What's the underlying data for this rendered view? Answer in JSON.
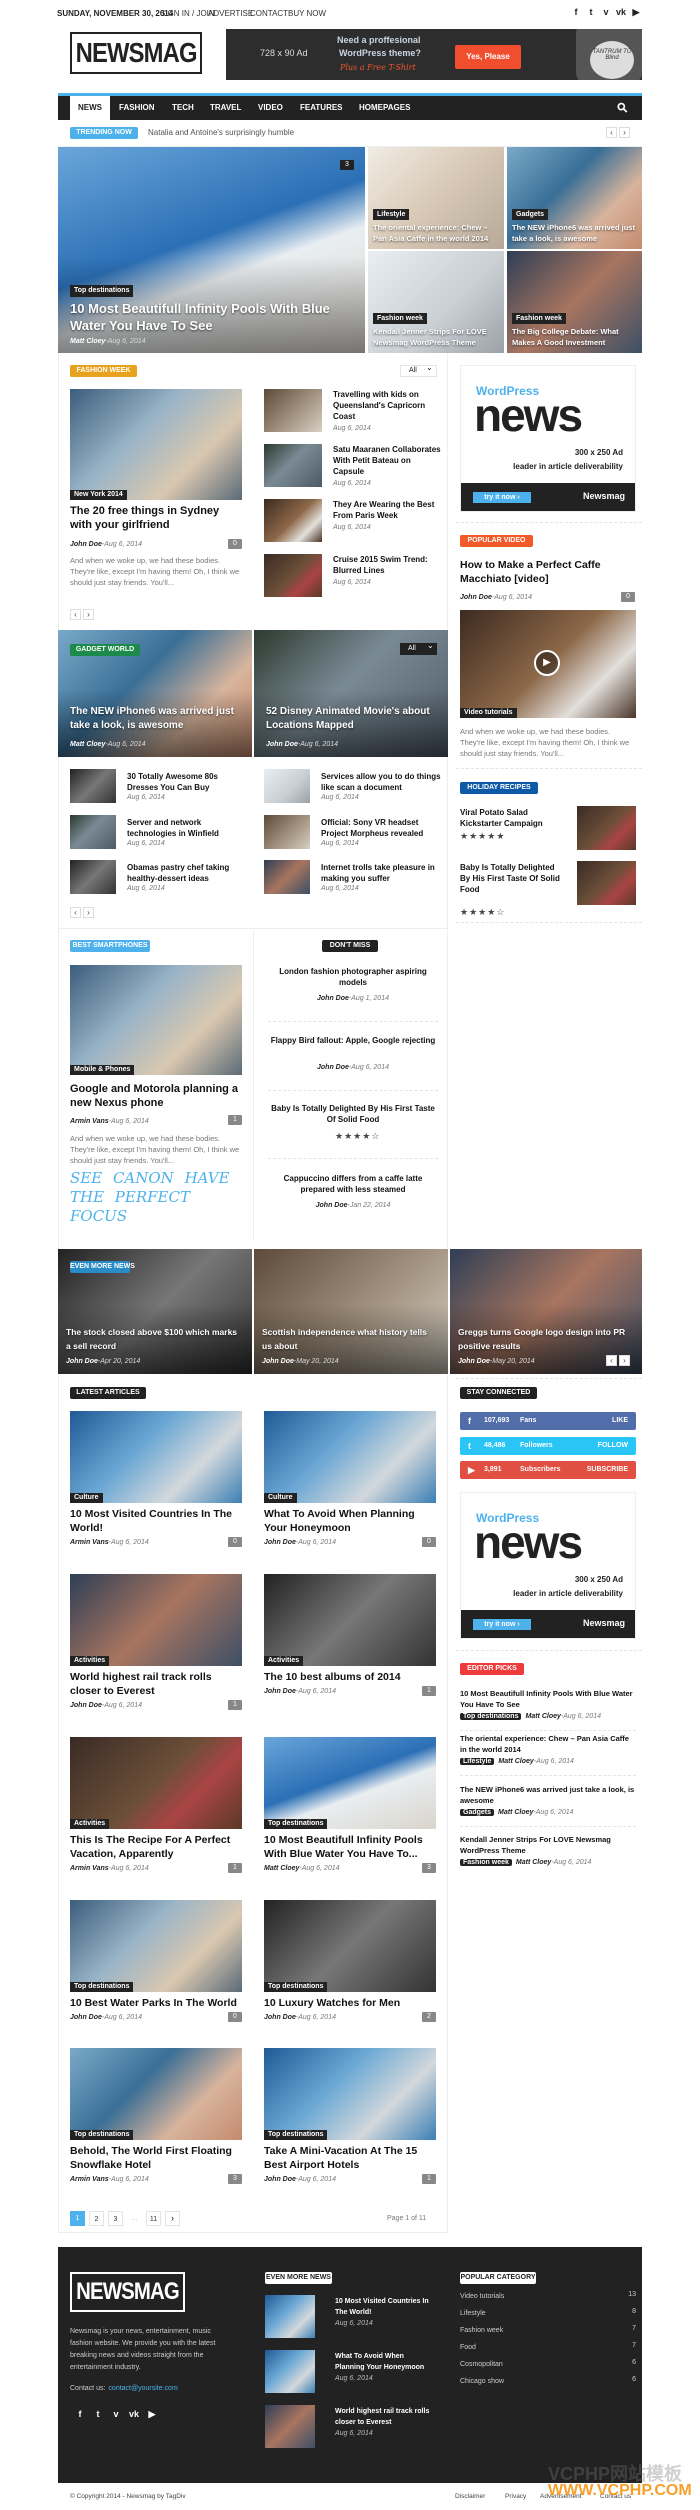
{
  "topbar": {
    "date": "SUNDAY, NOVEMBER 30, 2014",
    "links": [
      "SIGN IN / JOIN",
      "ADVERTISE",
      "CONTACT",
      "BUY NOW"
    ],
    "social": [
      "facebook-icon",
      "twitter-icon",
      "vimeo-icon",
      "vk-icon",
      "youtube-icon"
    ]
  },
  "header": {
    "logo": "NEWSMAG",
    "ad": {
      "size": "728 x 90 Ad",
      "line1": "Need a proffesional",
      "line2": "WordPress theme?",
      "line3": "Plus a Free T-Shirt",
      "button": "Yes, Please",
      "shirt_text": "TANTRUM TO Blind"
    }
  },
  "nav": {
    "items": [
      "NEWS",
      "FASHION",
      "TECH",
      "TRAVEL",
      "VIDEO",
      "FEATURES",
      "HOMEPAGES"
    ],
    "active": "NEWS"
  },
  "trending": {
    "label": "TRENDING NOW",
    "text": "Natalia and Antoine's surprisingly humble"
  },
  "hero": {
    "main": {
      "category": "Top destinations",
      "title": "10 Most Beautifull Infinity Pools With Blue Water You Have To See",
      "author": "Matt Cloey",
      "date": "Aug 6, 2014",
      "comments": "3"
    },
    "tiles": [
      {
        "category": "Lifestyle",
        "title": "The oriental experience: Chew – Pan Asia Caffe in the world 2014"
      },
      {
        "category": "Gadgets",
        "title": "The NEW iPhone6 was arrived just take a look, is awesome"
      },
      {
        "category": "Fashion week",
        "title": "Kendall Jenner Strips For LOVE Newsmag WordPress Theme"
      },
      {
        "category": "Fashion week",
        "title": "The Big College Debate: What Makes A Good Investment"
      }
    ]
  },
  "excerpt": "And when we woke up, we had these bodies. They're like, except I'm having them! Oh, I think we should just stay friends. You'll...",
  "fashion": {
    "label": "FASHION WEEK",
    "filter": "All",
    "main": {
      "category": "New York 2014",
      "title": "The 20 free things in Sydney with your girlfriend",
      "author": "John Doe",
      "date": "Aug 6, 2014",
      "comments": "0"
    },
    "list": [
      {
        "title": "Travelling with kids on Queensland's Capricorn Coast",
        "date": "Aug 6, 2014"
      },
      {
        "title": "Satu Maaranen Collaborates With Petit Bateau on Capsule",
        "date": "Aug 6, 2014"
      },
      {
        "title": "They Are Wearing the Best From Paris Week",
        "date": "Aug 6, 2014"
      },
      {
        "title": "Cruise 2015 Swim Trend: Blurred Lines",
        "date": "Aug 6, 2014"
      }
    ]
  },
  "gadget": {
    "label": "GADGET WORLD",
    "filter": "All",
    "tiles": [
      {
        "title": "The NEW iPhone6 was arrived just take a look, is awesome",
        "author": "Matt Cloey",
        "date": "Aug 6, 2014"
      },
      {
        "title": "52 Disney Animated Movie's about Locations Mapped",
        "author": "John Doe",
        "date": "Aug 6, 2014"
      }
    ],
    "list": [
      {
        "title": "30 Totally Awesome 80s Dresses You Can Buy",
        "date": "Aug 6, 2014"
      },
      {
        "title": "Services allow you to do things like scan a document",
        "date": "Aug 6, 2014"
      },
      {
        "title": "Server and network technologies in Winfield",
        "date": "Aug 6, 2014"
      },
      {
        "title": "Official: Sony VR headset Project Morpheus revealed",
        "date": "Aug 6, 2014"
      },
      {
        "title": "Obamas pastry chef taking healthy-dessert ideas",
        "date": "Aug 6, 2014"
      },
      {
        "title": "Internet trolls take pleasure in making you suffer",
        "date": "Aug 6, 2014"
      }
    ]
  },
  "smartphones": {
    "label": "BEST Smartphones",
    "main": {
      "category": "Mobile & Phones",
      "title": "Google and Motorola planning a new Nexus phone",
      "author": "Armin Vans",
      "date": "Aug 6, 2014",
      "comments": "1"
    },
    "promo": "SEE CANON HAVE THE PERFECT FOCUS"
  },
  "dont_miss": {
    "label": "DON'T MISS",
    "items": [
      {
        "title": "London fashion photographer aspiring models",
        "author": "John Doe",
        "date": "Aug 1, 2014"
      },
      {
        "title": "Flappy Bird fallout: Apple, Google rejecting",
        "author": "John Doe",
        "date": "Aug 6, 2014"
      },
      {
        "title": "Baby Is Totally Delighted By His First Taste Of Solid Food",
        "rating": 4
      },
      {
        "title": "Cappuccino differs from a caffe latte prepared with less steamed",
        "author": "John Doe",
        "date": "Jan 22, 2014"
      }
    ]
  },
  "even_more": {
    "label": "EVEN MORE NEWS",
    "items": [
      {
        "title": "The stock closed above $100 which marks a sell record",
        "author": "John Doe",
        "date": "Apr 20, 2014"
      },
      {
        "title": "Scottish independence what history tells us about",
        "author": "John Doe",
        "date": "May 20, 2014"
      },
      {
        "title": "Greggs turns Google logo design into PR positive results",
        "author": "John Doe",
        "date": "May 20, 2014"
      }
    ]
  },
  "latest": {
    "label": "LATEST ARTICLES",
    "items": [
      {
        "category": "Culture",
        "title": "10 Most Visited Countries In The World!",
        "author": "Armin Vans",
        "date": "Aug 6, 2014",
        "comments": "0"
      },
      {
        "category": "Culture",
        "title": "What To Avoid When Planning Your Honeymoon",
        "author": "John Doe",
        "date": "Aug 6, 2014",
        "comments": "0"
      },
      {
        "category": "Activities",
        "title": "World highest rail track rolls closer to Everest",
        "author": "John Doe",
        "date": "Aug 6, 2014",
        "comments": "1"
      },
      {
        "category": "Activities",
        "title": "The 10 best albums of 2014",
        "author": "John Doe",
        "date": "Aug 6, 2014",
        "comments": "1"
      },
      {
        "category": "Activities",
        "title": "This Is The Recipe For A Perfect Vacation, Apparently",
        "author": "Armin Vans",
        "date": "Aug 6, 2014",
        "comments": "1"
      },
      {
        "category": "Top destinations",
        "title": "10 Most Beautifull Infinity Pools With Blue Water You Have To...",
        "author": "Matt Cloey",
        "date": "Aug 6, 2014",
        "comments": "3"
      },
      {
        "category": "Top destinations",
        "title": "10 Best Water Parks In The World",
        "author": "John Doe",
        "date": "Aug 6, 2014",
        "comments": "0"
      },
      {
        "category": "Top destinations",
        "title": "10 Luxury Watches for Men",
        "author": "John Doe",
        "date": "Aug 6, 2014",
        "comments": "2"
      },
      {
        "category": "Top destinations",
        "title": "Behold, The World First Floating Snowflake Hotel",
        "author": "Armin Vans",
        "date": "Aug 6, 2014",
        "comments": "3"
      },
      {
        "category": "Top destinations",
        "title": "Take A Mini-Vacation At The 15 Best Airport Hotels",
        "author": "John Doe",
        "date": "Aug 6, 2014",
        "comments": "1"
      }
    ],
    "pagination": {
      "pages": [
        "1",
        "2",
        "3",
        "...",
        "11"
      ],
      "current": "1",
      "next": "›",
      "summary": "Page 1 of 11"
    }
  },
  "sidebar": {
    "ad": {
      "brand_top": "WordPress",
      "brand": "news",
      "size": "300 x 250 Ad",
      "tagline": "leader in article deliverability",
      "button": "try it now ›",
      "name": "Newsmag"
    },
    "popular_video": {
      "label": "POPULAR VIDEO",
      "title": "How to Make a Perfect Caffe Macchiato [video]",
      "author": "John Doe",
      "date": "Aug 6, 2014",
      "comments": "0",
      "category": "Video tutorials"
    },
    "holiday": {
      "label": "HOLIDAY RECIPES",
      "items": [
        {
          "title": "Viral Potato Salad Kickstarter Campaign",
          "rating": 4.5
        },
        {
          "title": "Baby Is Totally Delighted By His First Taste Of Solid Food",
          "rating": 4
        }
      ]
    },
    "stay_connected": {
      "label": "STAY CONNECTED",
      "rows": [
        {
          "icon": "facebook-icon",
          "count": "107,693",
          "unit": "Fans",
          "action": "LIKE",
          "color": "#516eab"
        },
        {
          "icon": "twitter-icon",
          "count": "48,486",
          "unit": "Followers",
          "action": "FOLLOW",
          "color": "#29c5f6"
        },
        {
          "icon": "youtube-icon",
          "count": "3,891",
          "unit": "Subscribers",
          "action": "SUBSCRIBE",
          "color": "#e14e42"
        }
      ]
    },
    "editor_picks": {
      "label": "EDITOR PICKS",
      "items": [
        {
          "title": "10 Most Beautifull Infinity Pools With Blue Water You Have To See",
          "category": "Top destinations",
          "author": "Matt Cloey",
          "date": "Aug 6, 2014"
        },
        {
          "title": "The oriental experience: Chew – Pan Asia Caffe in the world 2014",
          "category": "Lifestyle",
          "author": "Matt Cloey",
          "date": "Aug 6, 2014"
        },
        {
          "title": "The NEW iPhone6 was arrived just take a look, is awesome",
          "category": "Gadgets",
          "author": "Matt Cloey",
          "date": "Aug 6, 2014"
        },
        {
          "title": "Kendall Jenner Strips For LOVE Newsmag WordPress Theme",
          "category": "Fashion week",
          "author": "Matt Cloey",
          "date": "Aug 6, 2014"
        }
      ]
    }
  },
  "footer": {
    "logo": "NEWSMAG",
    "description": "Newsmag is your news, entertainment, music fashion website. We provide you with the latest breaking news and videos straight from the entertainment industry.",
    "contact_label": "Contact us:",
    "contact_email": "contact@yoursite.com",
    "even_more_label": "EVEN MORE NEWS",
    "even_more": [
      {
        "title": "10 Most Visited Countries In The World!",
        "date": "Aug 6, 2014"
      },
      {
        "title": "What To Avoid When Planning Your Honeymoon",
        "date": "Aug 6, 2014"
      },
      {
        "title": "World highest rail track rolls closer to Everest",
        "date": "Aug 6, 2014"
      }
    ],
    "popular_label": "POPULAR CATEGORY",
    "categories": [
      {
        "name": "Video tutorials",
        "count": "13"
      },
      {
        "name": "Lifestyle",
        "count": "8"
      },
      {
        "name": "Fashion week",
        "count": "7"
      },
      {
        "name": "Food",
        "count": "7"
      },
      {
        "name": "Cosmopolitan",
        "count": "6"
      },
      {
        "name": "Chicago show",
        "count": "6"
      }
    ],
    "copyright": "© Copyright 2014 - Newsmag by TagDiv",
    "links": [
      "Disclaimer",
      "Privacy",
      "Advertisement",
      "Contact us"
    ]
  },
  "watermark": {
    "line1": "VCPHP网站模板",
    "line2": "WWW.VCPHP.COM"
  },
  "colors": {
    "accent": "#4db2ec",
    "nav": "#222222",
    "fashion": "#e9a21d",
    "popular_video": "#f25a2a",
    "holiday": "#0e5aa7",
    "gadget": "#1c8a4a",
    "even_more": "#2a8cc7",
    "editor_picks": "#ee3b3b"
  }
}
